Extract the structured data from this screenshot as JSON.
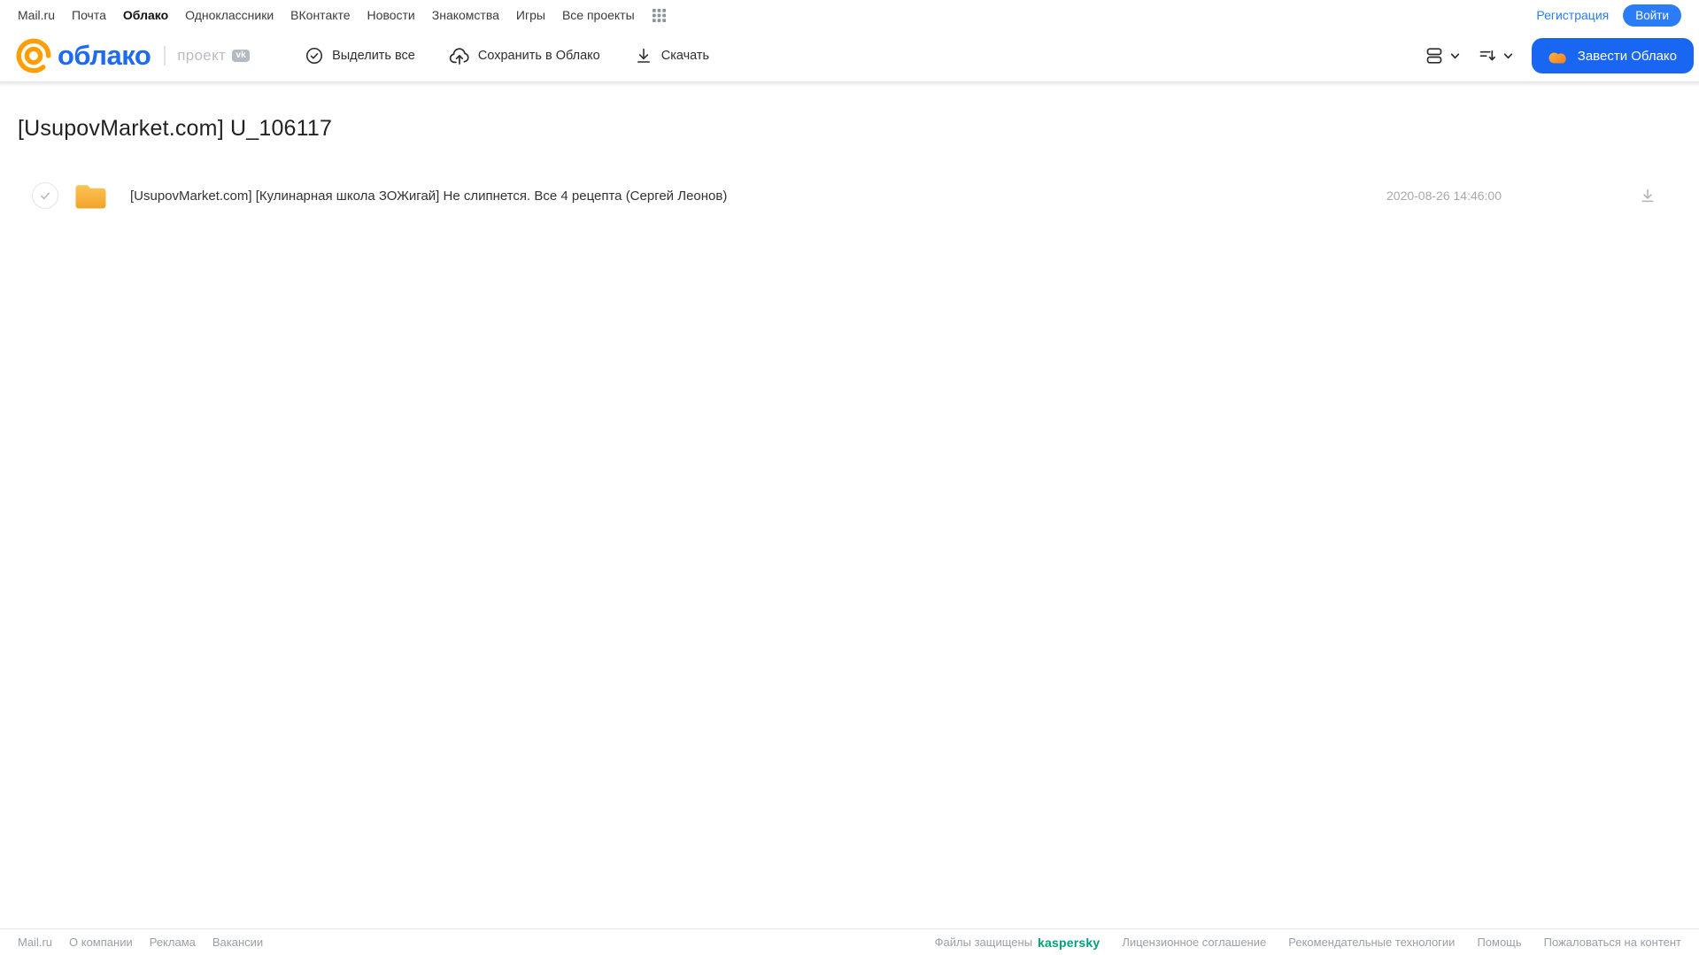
{
  "topnav": {
    "links": [
      "Mail.ru",
      "Почта",
      "Облако",
      "Одноклассники",
      "ВКонтакте",
      "Новости",
      "Знакомства",
      "Игры",
      "Все проекты"
    ],
    "active_link": "Облако",
    "registration_label": "Регистрация",
    "login_label": "Войти"
  },
  "header": {
    "logo_text": "облако",
    "project_label": "проект",
    "vk_badge": "vk",
    "toolbar": [
      {
        "icon": "check-circle-icon",
        "label": "Выделить все"
      },
      {
        "icon": "cloud-upload-icon",
        "label": "Сохранить в Облако"
      },
      {
        "icon": "download-icon",
        "label": "Скачать"
      }
    ],
    "view_controls": [
      {
        "icon": "view-list-icon"
      },
      {
        "icon": "sort-icon"
      }
    ],
    "create_cloud_label": "Завести Облако"
  },
  "main": {
    "title": "[UsupovMarket.com] U_106117",
    "files": [
      {
        "type": "folder",
        "icon": "folder-icon",
        "name": "[UsupovMarket.com] [Кулинарная школа ЗОЖигай] Не слипнется. Все 4 рецепта (Сергей Леонов)",
        "date": "2020-08-26 14:46:00",
        "download_icon": "download-icon"
      }
    ]
  },
  "footer": {
    "left_links": [
      "Mail.ru",
      "О компании",
      "Реклама",
      "Вакансии"
    ],
    "protected_label": "Файлы защищены",
    "kaspersky_label": "kaspersky",
    "right_links": [
      "Лицензионное соглашение",
      "Рекомендательные технологии",
      "Помощь",
      "Пожаловаться на контент"
    ]
  },
  "colors": {
    "accent_blue": "#1966f2",
    "link_blue": "#2b7cf7",
    "logo_orange": "#ff9e00",
    "folder_amber": "#f9b64a",
    "kaspersky_green": "#00a17a"
  }
}
